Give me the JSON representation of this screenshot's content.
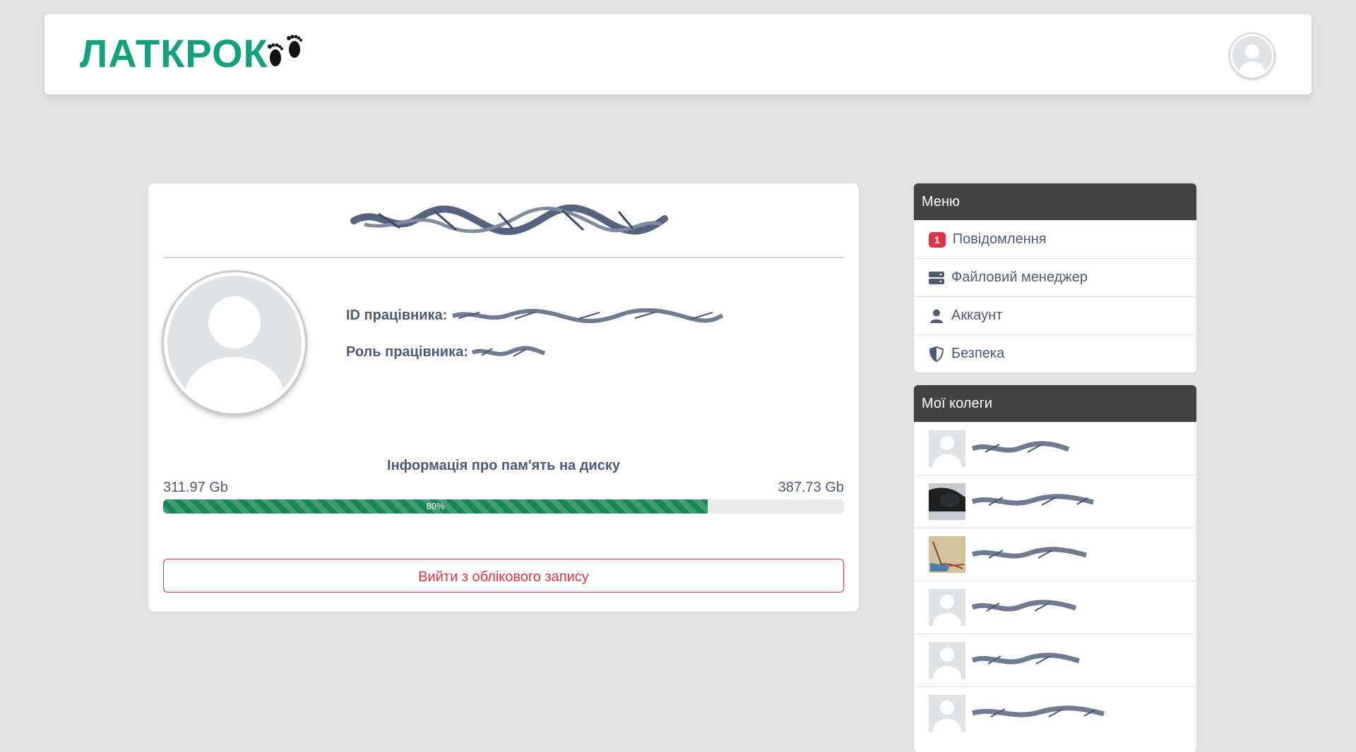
{
  "brand": {
    "logo_text": "ЛАТКРОК",
    "accent_color": "#14a07d"
  },
  "profile": {
    "employee_id_label": "ID працівника:",
    "employee_role_label": "Роль працівника:",
    "disk": {
      "title": "Інформація про пам'ять на диску",
      "used": "311.97 Gb",
      "total": "387.73 Gb",
      "percent_label": "80%",
      "percent": 80
    },
    "logout_label": "Вийти з облікового запису"
  },
  "menu": {
    "title": "Меню",
    "items": [
      {
        "label": "Повідомлення",
        "badge": "1",
        "icon": "badge"
      },
      {
        "label": "Файловий менеджер",
        "icon": "server-icon"
      },
      {
        "label": "Аккаунт",
        "icon": "user-icon"
      },
      {
        "label": "Безпека",
        "icon": "shield-icon"
      }
    ]
  },
  "colleagues": {
    "title": "Мої колеги"
  },
  "colors": {
    "danger": "#dc3545",
    "success": "#198754",
    "panel_header": "#424242",
    "text": "#4d5a73"
  }
}
